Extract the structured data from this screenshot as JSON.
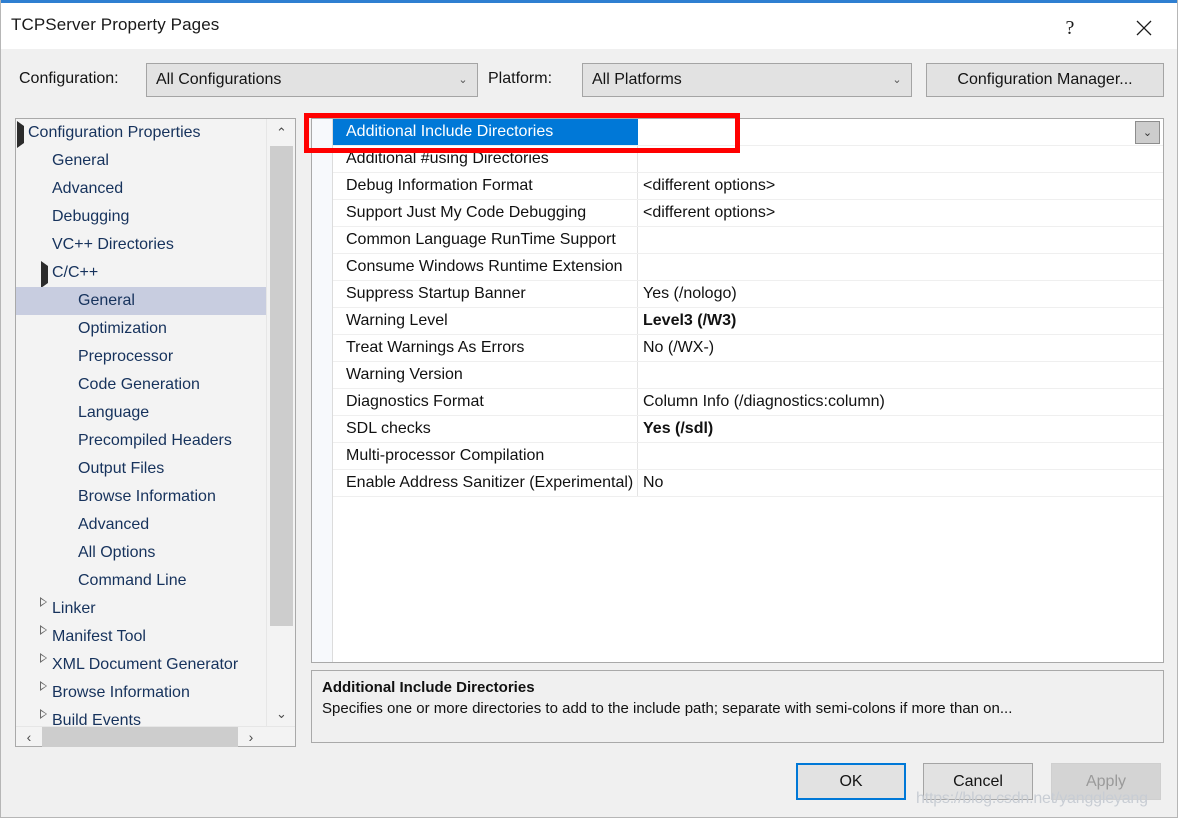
{
  "window": {
    "title": "TCPServer Property Pages",
    "help_glyph": "?",
    "close_glyph": "✕",
    "accent_color": "#2f7fd1"
  },
  "config_bar": {
    "configuration_label": "Configuration:",
    "configuration_value": "All Configurations",
    "platform_label": "Platform:",
    "platform_value": "All Platforms",
    "configuration_manager_label": "Configuration Manager...",
    "dropdown_glyph": "⌄"
  },
  "tree": {
    "scroll_up_glyph": "⌃",
    "scroll_down_glyph": "⌄",
    "scroll_left_glyph": "‹",
    "scroll_right_glyph": "›",
    "items": [
      {
        "label": "Configuration Properties",
        "indent": 0,
        "expander": "open",
        "selected": false
      },
      {
        "label": "General",
        "indent": 1,
        "expander": "none",
        "selected": false
      },
      {
        "label": "Advanced",
        "indent": 1,
        "expander": "none",
        "selected": false
      },
      {
        "label": "Debugging",
        "indent": 1,
        "expander": "none",
        "selected": false
      },
      {
        "label": "VC++ Directories",
        "indent": 1,
        "expander": "none",
        "selected": false
      },
      {
        "label": "C/C++",
        "indent": 1,
        "expander": "open",
        "selected": false
      },
      {
        "label": "General",
        "indent": 2,
        "expander": "none",
        "selected": true
      },
      {
        "label": "Optimization",
        "indent": 2,
        "expander": "none",
        "selected": false
      },
      {
        "label": "Preprocessor",
        "indent": 2,
        "expander": "none",
        "selected": false
      },
      {
        "label": "Code Generation",
        "indent": 2,
        "expander": "none",
        "selected": false
      },
      {
        "label": "Language",
        "indent": 2,
        "expander": "none",
        "selected": false
      },
      {
        "label": "Precompiled Headers",
        "indent": 2,
        "expander": "none",
        "selected": false
      },
      {
        "label": "Output Files",
        "indent": 2,
        "expander": "none",
        "selected": false
      },
      {
        "label": "Browse Information",
        "indent": 2,
        "expander": "none",
        "selected": false
      },
      {
        "label": "Advanced",
        "indent": 2,
        "expander": "none",
        "selected": false
      },
      {
        "label": "All Options",
        "indent": 2,
        "expander": "none",
        "selected": false
      },
      {
        "label": "Command Line",
        "indent": 2,
        "expander": "none",
        "selected": false
      },
      {
        "label": "Linker",
        "indent": 1,
        "expander": "closed",
        "selected": false
      },
      {
        "label": "Manifest Tool",
        "indent": 1,
        "expander": "closed",
        "selected": false
      },
      {
        "label": "XML Document Generator",
        "indent": 1,
        "expander": "closed",
        "selected": false
      },
      {
        "label": "Browse Information",
        "indent": 1,
        "expander": "closed",
        "selected": false
      },
      {
        "label": "Build Events",
        "indent": 1,
        "expander": "closed",
        "selected": false
      }
    ]
  },
  "grid": {
    "dropdown_glyph": "⌄",
    "rows": [
      {
        "name": "Additional Include Directories",
        "value": "",
        "selected": true,
        "modified": false
      },
      {
        "name": "Additional #using Directories",
        "value": "",
        "selected": false,
        "modified": false
      },
      {
        "name": "Debug Information Format",
        "value": "<different options>",
        "selected": false,
        "modified": false
      },
      {
        "name": "Support Just My Code Debugging",
        "value": "<different options>",
        "selected": false,
        "modified": false
      },
      {
        "name": "Common Language RunTime Support",
        "value": "",
        "selected": false,
        "modified": false
      },
      {
        "name": "Consume Windows Runtime Extension",
        "value": "",
        "selected": false,
        "modified": false
      },
      {
        "name": "Suppress Startup Banner",
        "value": "Yes (/nologo)",
        "selected": false,
        "modified": false
      },
      {
        "name": "Warning Level",
        "value": "Level3 (/W3)",
        "selected": false,
        "modified": true
      },
      {
        "name": "Treat Warnings As Errors",
        "value": "No (/WX-)",
        "selected": false,
        "modified": false
      },
      {
        "name": "Warning Version",
        "value": "",
        "selected": false,
        "modified": false
      },
      {
        "name": "Diagnostics Format",
        "value": "Column Info (/diagnostics:column)",
        "selected": false,
        "modified": false
      },
      {
        "name": "SDL checks",
        "value": "Yes (/sdl)",
        "selected": false,
        "modified": true
      },
      {
        "name": "Multi-processor Compilation",
        "value": "",
        "selected": false,
        "modified": false
      },
      {
        "name": "Enable Address Sanitizer (Experimental)",
        "value": "No",
        "selected": false,
        "modified": false
      }
    ]
  },
  "description": {
    "title": "Additional Include Directories",
    "text": "Specifies one or more directories to add to the include path; separate with semi-colons if more than on..."
  },
  "footer": {
    "ok_label": "OK",
    "cancel_label": "Cancel",
    "apply_label": "Apply"
  },
  "watermark": {
    "text": "https://blog.csdn.net/yanggleyang"
  }
}
